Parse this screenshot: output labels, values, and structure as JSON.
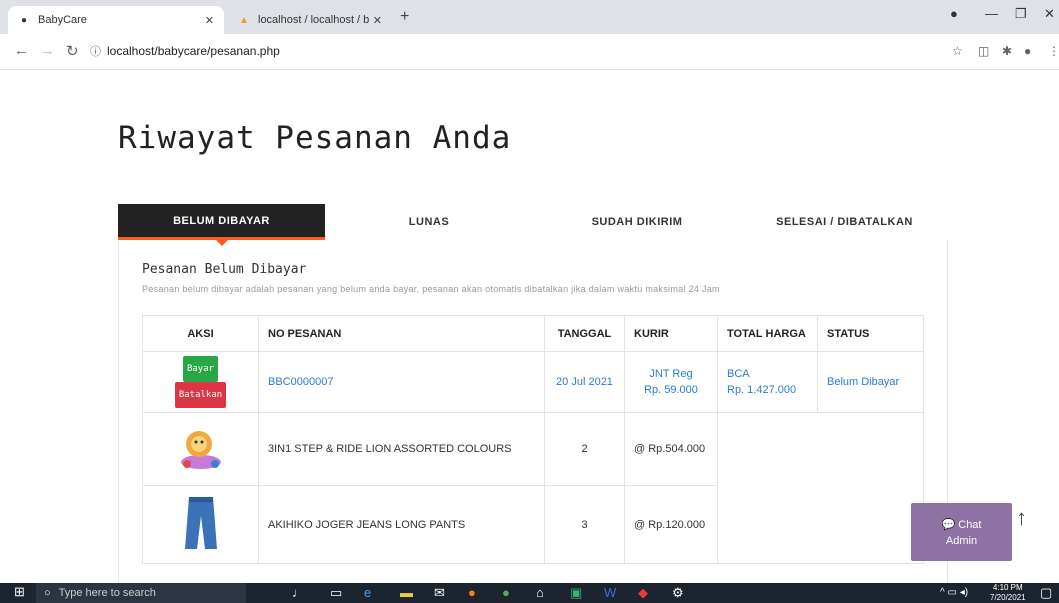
{
  "browser": {
    "active_tab_title": "BabyCare",
    "inactive_tab_title": "localhost / localhost / babycare /",
    "url": "localhost/babycare/pesanan.php"
  },
  "page": {
    "title": "Riwayat Pesanan Anda",
    "tabs": [
      {
        "label": "BELUM DIBAYAR",
        "active": true
      },
      {
        "label": "LUNAS",
        "active": false
      },
      {
        "label": "SUDAH DIKIRIM",
        "active": false
      },
      {
        "label": "SELESAI / DIBATALKAN",
        "active": false
      }
    ],
    "section_title": "Pesanan Belum Dibayar",
    "section_subtitle": "Pesanan belum dibayar adalah pesanan yang belum anda bayar, pesanan akan otomatis dibatalkan jika dalam waktu maksimal 24 Jam"
  },
  "table": {
    "headers": [
      "AKSI",
      "NO PESANAN",
      "TANGGAL",
      "KURIR",
      "TOTAL HARGA",
      "STATUS"
    ],
    "order": {
      "pay_label": "Bayar",
      "cancel_label": "Batalkan",
      "number": "BBC0000007",
      "date": "20 Jul 2021",
      "courier_name": "JNT Reg",
      "courier_cost": "Rp. 59.000",
      "payment_bank": "BCA",
      "total": "Rp. 1.427.000",
      "status": "Belum Dibayar"
    },
    "items": [
      {
        "name": "3IN1 STEP & RIDE LION ASSORTED COLOURS",
        "qty": "2",
        "price": "@ Rp.504.000",
        "image": "toy-lion"
      },
      {
        "name": "AKIHIKO JOGER JEANS LONG PANTS",
        "qty": "3",
        "price": "@ Rp.120.000",
        "image": "jeans-pants"
      }
    ]
  },
  "chat": {
    "label_line1": "Chat",
    "label_line2": "Admin"
  },
  "taskbar": {
    "search_placeholder": "Type here to search",
    "time": "4:10 PM",
    "date": "7/20/2021"
  },
  "colors": {
    "accent": "#ff5a1f",
    "link": "#2a7bd6",
    "pay": "#28a745",
    "cancel": "#dc3545",
    "chat": "#8e72a6"
  }
}
